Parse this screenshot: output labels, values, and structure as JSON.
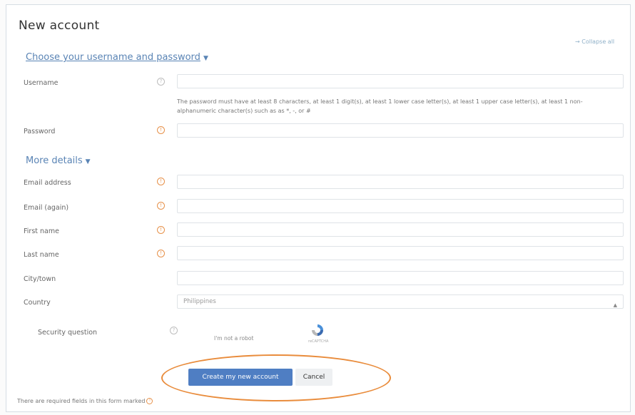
{
  "page": {
    "title": "New account",
    "collapse_all": "→ Collapse all"
  },
  "sections": {
    "credentials": "Choose your username and password",
    "more_details": "More details"
  },
  "fields": {
    "username": {
      "label": "Username",
      "value": ""
    },
    "password_hint": "The password must have at least 8 characters, at least 1 digit(s), at least 1 lower case letter(s), at least 1 upper case letter(s), at least 1 non-alphanumeric character(s) such as as *, -, or #",
    "password": {
      "label": "Password",
      "value": ""
    },
    "email": {
      "label": "Email address",
      "value": ""
    },
    "email_again": {
      "label": "Email (again)",
      "value": ""
    },
    "first_name": {
      "label": "First name",
      "value": ""
    },
    "last_name": {
      "label": "Last name",
      "value": ""
    },
    "city": {
      "label": "City/town",
      "value": ""
    },
    "country": {
      "label": "Country",
      "selected": "Philippines"
    },
    "security": {
      "label": "Security question",
      "robot_text": "I'm not a robot",
      "recaptcha_sub": "reCAPTCHA"
    }
  },
  "buttons": {
    "create": "Create my new account",
    "cancel": "Cancel"
  },
  "footer": {
    "required_note": "There are required fields in this form marked"
  },
  "colors": {
    "accent": "#4f7ec3",
    "required": "#e7914a",
    "annotation": "#e98c3c"
  },
  "icons": {
    "required": "exclamation-circle-icon",
    "help": "question-circle-icon",
    "caret": "caret-down-icon",
    "recaptcha": "recaptcha-icon"
  }
}
